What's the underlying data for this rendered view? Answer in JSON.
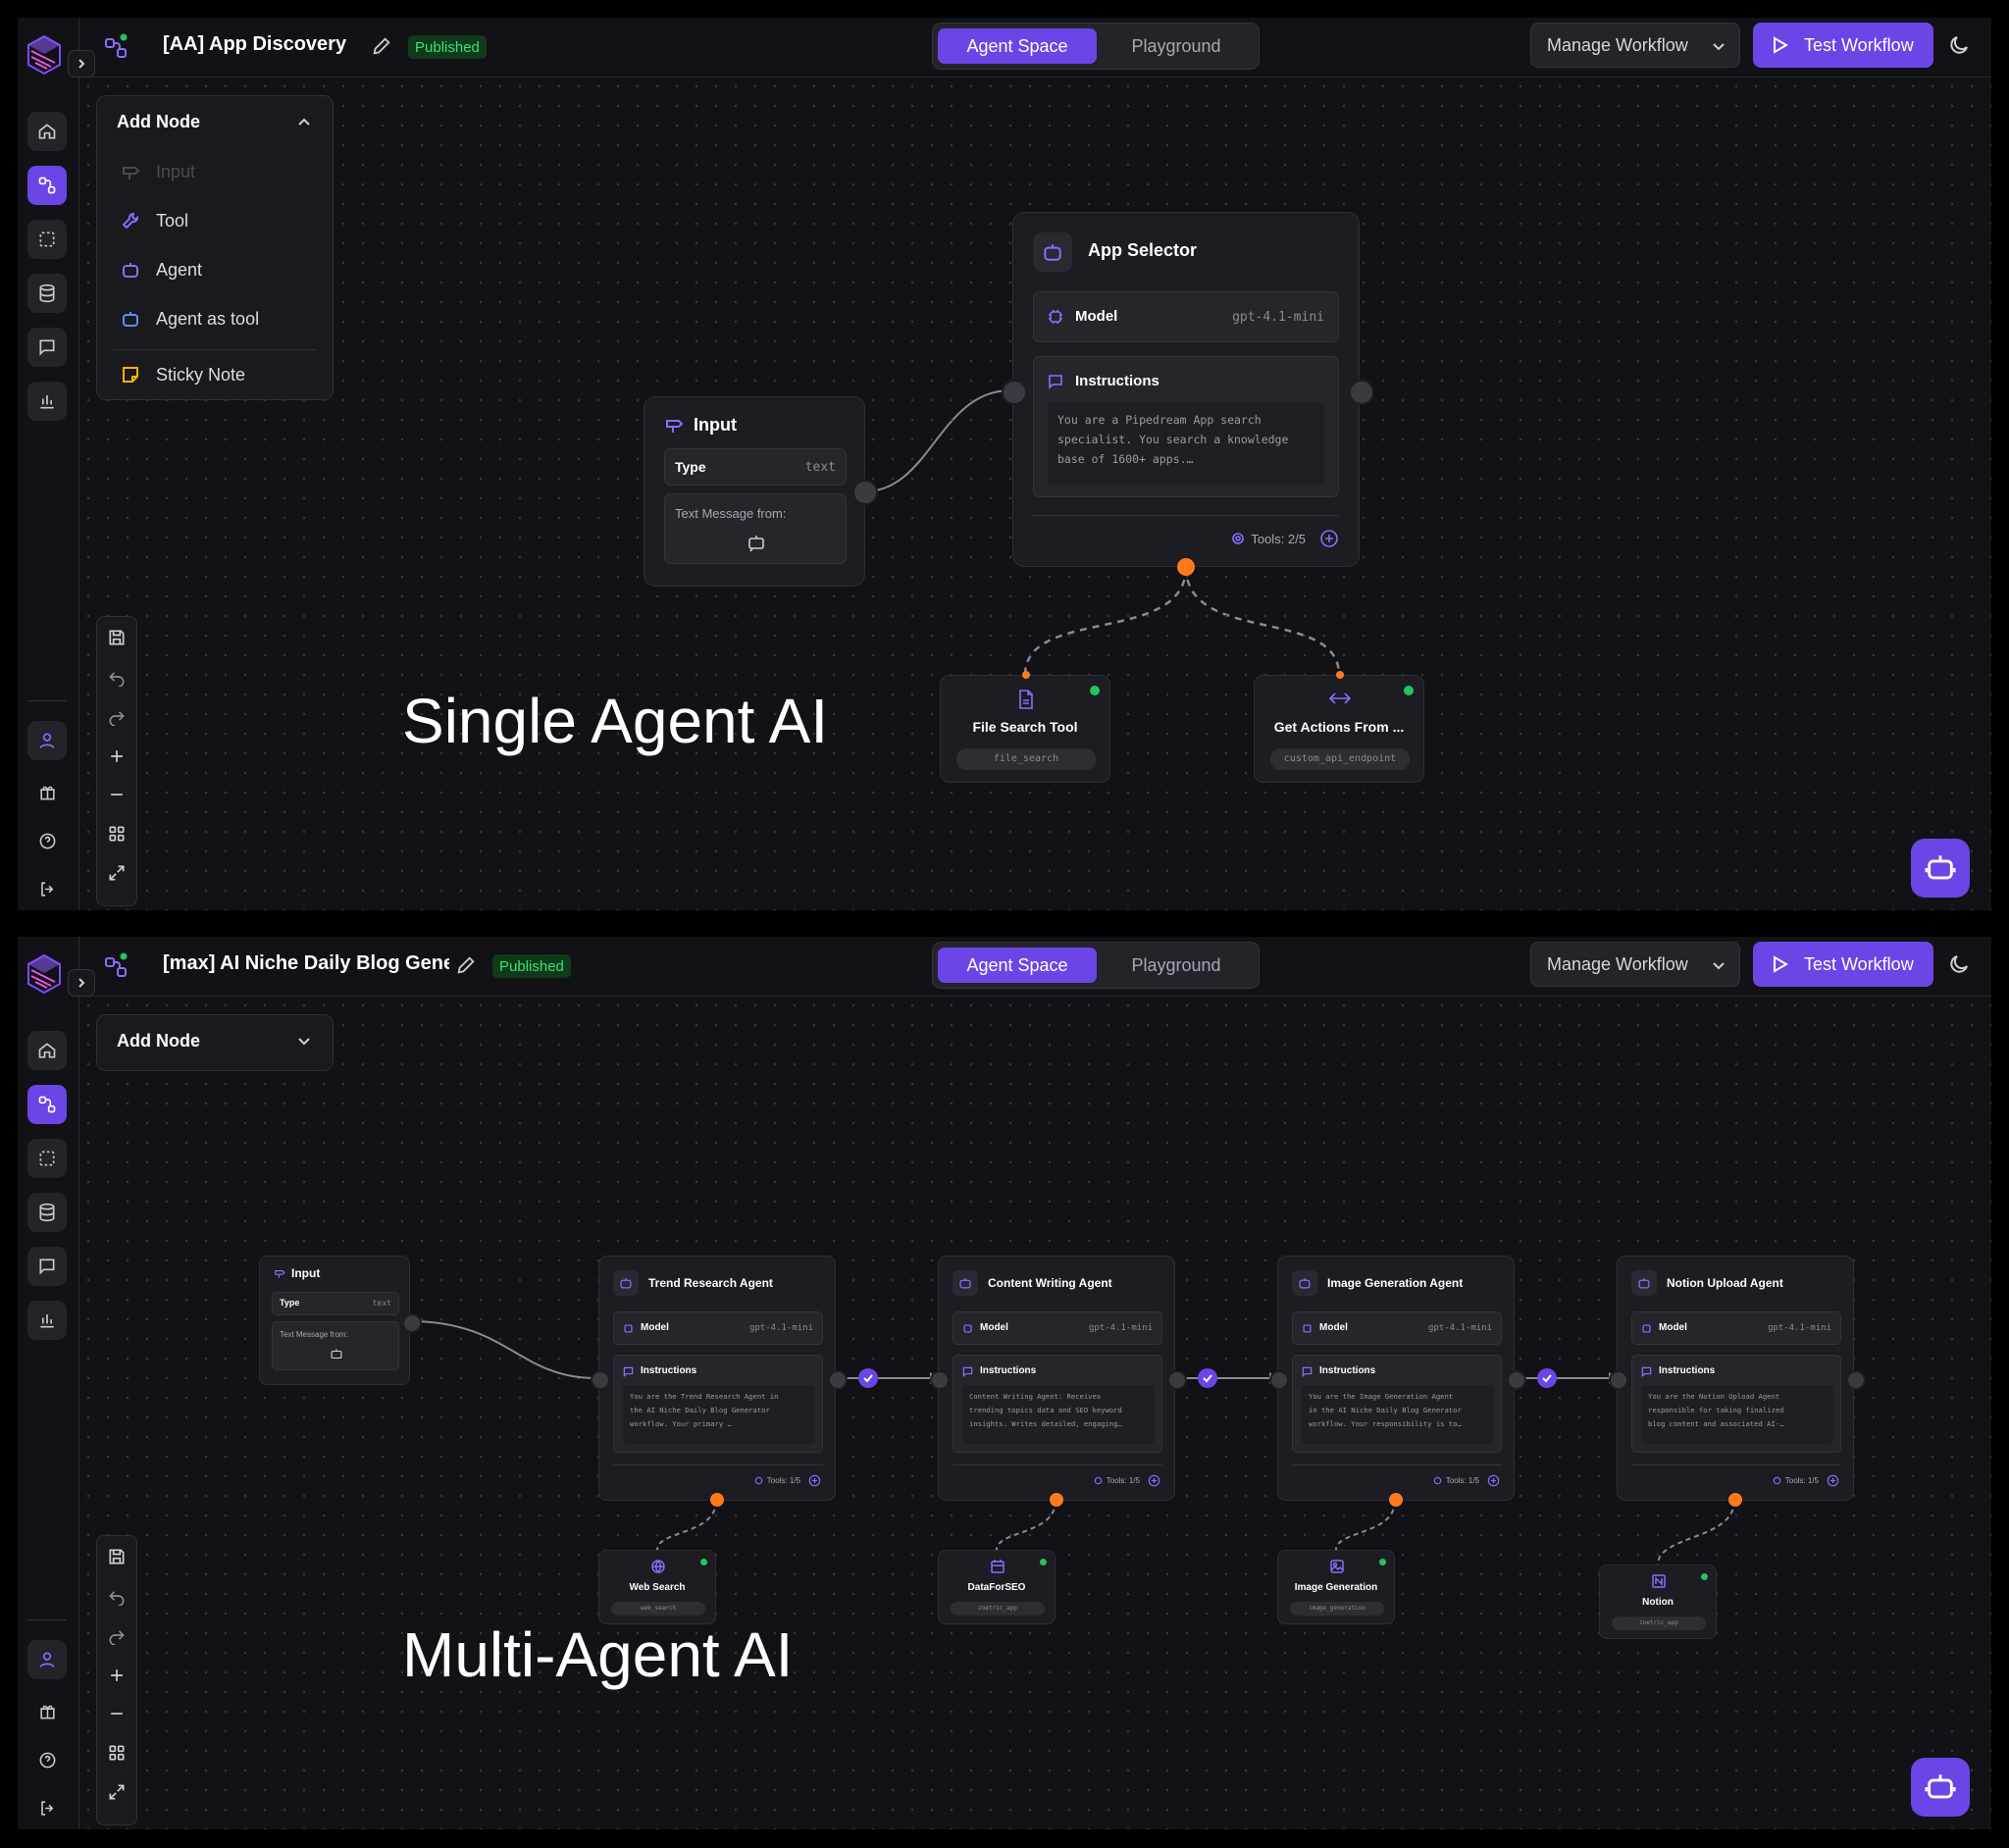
{
  "colors": {
    "accent": "#6a46e6",
    "published": "#3ee070",
    "handle_orange": "#ff7a1a",
    "status_dot": "#22c55e"
  },
  "nav": {
    "tab_agent_space": "Agent Space",
    "tab_playground": "Playground",
    "manage_workflow": "Manage Workflow",
    "test_workflow": "Test Workflow"
  },
  "icons": {
    "logo": "cube-logo",
    "home": "home-icon",
    "workflows": "workflow-icon",
    "select": "select-icon",
    "database": "database-icon",
    "chat": "chat-icon",
    "analytics": "bar-chart-icon",
    "user": "user-icon",
    "gift": "gift-icon",
    "help": "help-icon",
    "logout": "logout-icon",
    "bot": "robot-icon"
  },
  "single": {
    "title": "[AA] App Discovery",
    "status": "Published",
    "caption": "Single Agent AI",
    "add_node": {
      "label": "Add Node",
      "items": [
        {
          "label": "Input",
          "icon": "signpost-icon",
          "disabled": true
        },
        {
          "label": "Tool",
          "icon": "wrench-icon",
          "disabled": false
        },
        {
          "label": "Agent",
          "icon": "robot-icon",
          "disabled": false
        },
        {
          "label": "Agent as tool",
          "icon": "robot-icon",
          "disabled": false
        }
      ],
      "sticky": "Sticky Note"
    },
    "input_node": {
      "title": "Input",
      "type_label": "Type",
      "type_value": "text",
      "text_label": "Text Message from:"
    },
    "agent_node": {
      "title": "App Selector",
      "model_label": "Model",
      "model_value": "gpt-4.1-mini",
      "instructions_label": "Instructions",
      "instructions_lines": [
        "You are a Pipedream App search",
        "specialist. You search a knowledge",
        "base of 1600+ apps.…"
      ],
      "tools": "Tools: 2/5"
    },
    "tools": [
      {
        "title": "File Search Tool",
        "tag": "file_search",
        "icon": "file-icon"
      },
      {
        "title": "Get Actions From ...",
        "tag": "custom_api_endpoint",
        "icon": "code-arrows-icon"
      }
    ]
  },
  "multi": {
    "title": "[max] AI Niche Daily Blog Gene",
    "status": "Published",
    "caption": "Multi-Agent AI",
    "add_node_label": "Add Node",
    "input_node": {
      "title": "Input",
      "type_label": "Type",
      "type_value": "text",
      "text_label": "Text Message from:"
    },
    "agents": [
      {
        "title": "Trend Research Agent",
        "model_label": "Model",
        "model_value": "gpt-4.1-mini",
        "instructions_label": "Instructions",
        "instructions_lines": [
          "You are the Trend Research Agent in",
          "the AI Niche Daily Blog Generator",
          "workflow. Your primary …"
        ],
        "tools": "Tools: 1/5"
      },
      {
        "title": "Content Writing Agent",
        "model_label": "Model",
        "model_value": "gpt-4.1-mini",
        "instructions_label": "Instructions",
        "instructions_lines": [
          "Content Writing Agent: Receives",
          "trending topics data and SEO keyword",
          "insights. Writes detailed, engaging…"
        ],
        "tools": "Tools: 1/5"
      },
      {
        "title": "Image Generation Agent",
        "model_label": "Model",
        "model_value": "gpt-4.1-mini",
        "instructions_label": "Instructions",
        "instructions_lines": [
          "You are the Image Generation Agent",
          "in the AI Niche Daily Blog Generator",
          "workflow. Your responsibility is to…"
        ],
        "tools": "Tools: 1/5"
      },
      {
        "title": "Notion Upload Agent",
        "model_label": "Model",
        "model_value": "gpt-4.1-mini",
        "instructions_label": "Instructions",
        "instructions_lines": [
          "You are the Notion Upload Agent",
          "responsible for taking finalized",
          "blog content and associated AI-…"
        ],
        "tools": "Tools: 1/5"
      }
    ],
    "tools": [
      {
        "title": "Web Search",
        "tag": "web_search",
        "icon": "globe-icon"
      },
      {
        "title": "DataForSEO",
        "tag": "zoetric_app",
        "icon": "calendar-icon"
      },
      {
        "title": "Image Generation",
        "tag": "image_generation",
        "icon": "image-icon"
      },
      {
        "title": "Notion",
        "tag": "zoetric_app",
        "icon": "notion-icon"
      }
    ]
  }
}
